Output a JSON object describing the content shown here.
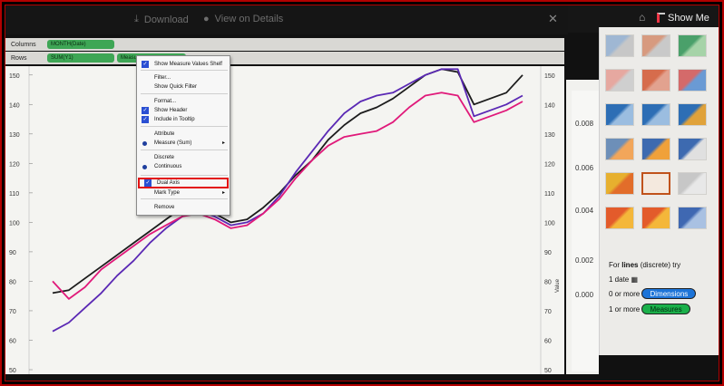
{
  "toolbar": {
    "download_label": "Download",
    "view_details_label": "View on Details",
    "show_me_label": "Show Me"
  },
  "shelves": {
    "columns_label": "Columns",
    "columns_pill": "MONTH(Date)",
    "rows_label": "Rows",
    "rows_pill_1": "SUM(Y1)",
    "rows_pill_2": "Measure"
  },
  "context_menu": {
    "items": [
      {
        "label": "Show Measure Values Shelf",
        "checked": true
      },
      {
        "label": "Filter...",
        "checked": false
      },
      {
        "label": "Show Quick Filter",
        "checked": false
      },
      {
        "label": "Format...",
        "checked": false
      },
      {
        "label": "Show Header",
        "checked": true
      },
      {
        "label": "Include in Tooltip",
        "checked": true
      },
      {
        "label": "Attribute",
        "checked": false
      },
      {
        "label": "Measure (Sum)",
        "radio": true,
        "submenu": true
      },
      {
        "label": "Discrete",
        "checked": false
      },
      {
        "label": "Continuous",
        "radio": true
      },
      {
        "label": "Dual Axis",
        "checked": true,
        "highlighted": true
      },
      {
        "label": "Mark Type",
        "submenu": true
      },
      {
        "label": "Remove",
        "checked": false
      }
    ]
  },
  "chart_data": {
    "type": "line",
    "left_axis": {
      "ticks": [
        50,
        60,
        70,
        80,
        90,
        100,
        110,
        120,
        130,
        140,
        150
      ],
      "ylim": [
        50,
        153
      ]
    },
    "center_axis": {
      "ticks": [
        50,
        60,
        70,
        80,
        90,
        100,
        110,
        120,
        130,
        140,
        150
      ],
      "ylim": [
        50,
        153
      ],
      "label": "Value"
    },
    "right_axis": {
      "ticks": [
        "0.000",
        "0.002",
        "0.004",
        "0.006",
        "0.008"
      ]
    },
    "x_count": 30,
    "series": [
      {
        "color": "#1c1c1c",
        "values": [
          76,
          77,
          81,
          85,
          89,
          93,
          97,
          101,
          105,
          107,
          103,
          100,
          101,
          105,
          110,
          116,
          121,
          128,
          133,
          137,
          139,
          142,
          146,
          150,
          152,
          151,
          140,
          142,
          144,
          150
        ]
      },
      {
        "color": "#5a28b4",
        "values": [
          63,
          66,
          71,
          76,
          82,
          87,
          93,
          98,
          102,
          104,
          102,
          99,
          100,
          103,
          109,
          117,
          124,
          131,
          137,
          141,
          143,
          144,
          147,
          150,
          152,
          152,
          136,
          138,
          140,
          143
        ]
      },
      {
        "color": "#e0197a",
        "values": [
          80,
          74,
          78,
          84,
          88,
          92,
          96,
          99,
          102,
          103,
          101,
          98,
          99,
          103,
          108,
          115,
          121,
          126,
          129,
          130,
          131,
          134,
          139,
          143,
          144,
          143,
          134,
          136,
          138,
          141
        ]
      }
    ]
  },
  "show_me": {
    "hint_prefix": "For ",
    "hint_bold": "lines",
    "hint_suffix": " (discrete) try",
    "date_req": "1 date",
    "dim_req": "0 or more",
    "dim_badge": "Dimensions",
    "mea_req": "1 or more",
    "mea_badge": "Measures"
  }
}
